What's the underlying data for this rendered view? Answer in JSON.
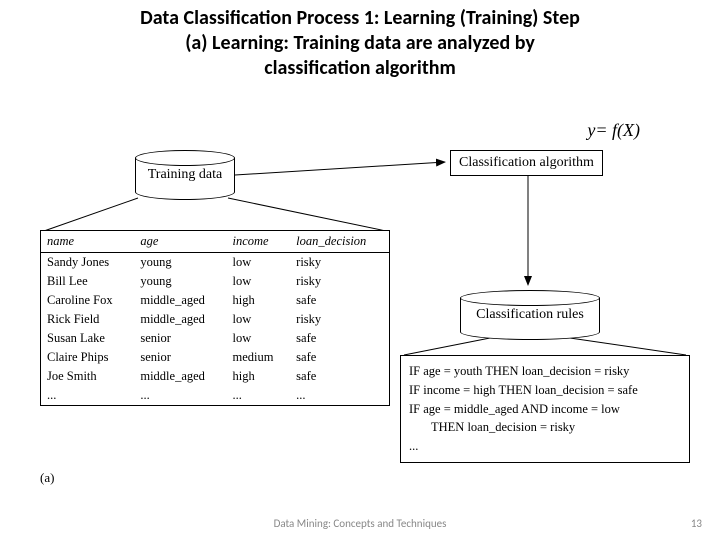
{
  "title": {
    "line1": "Data Classification Process 1: Learning (Training) Step",
    "line2": "(a) Learning: Training data are analyzed by",
    "line3": "classification algorithm"
  },
  "equation": "y= f(X)",
  "labels": {
    "training_data": "Training data",
    "classification_algorithm": "Classification algorithm",
    "classification_rules": "Classification rules",
    "sub": "(a)"
  },
  "table": {
    "headers": [
      "name",
      "age",
      "income",
      "loan_decision"
    ],
    "rows": [
      [
        "Sandy Jones",
        "young",
        "low",
        "risky"
      ],
      [
        "Bill Lee",
        "young",
        "low",
        "risky"
      ],
      [
        "Caroline Fox",
        "middle_aged",
        "high",
        "safe"
      ],
      [
        "Rick Field",
        "middle_aged",
        "low",
        "risky"
      ],
      [
        "Susan Lake",
        "senior",
        "low",
        "safe"
      ],
      [
        "Claire Phips",
        "senior",
        "medium",
        "safe"
      ],
      [
        "Joe Smith",
        "middle_aged",
        "high",
        "safe"
      ],
      [
        "...",
        "...",
        "...",
        "..."
      ]
    ]
  },
  "rules": {
    "r1": "IF age = youth THEN loan_decision = risky",
    "r2": "IF income = high THEN loan_decision = safe",
    "r3a": "IF age = middle_aged AND income = low",
    "r3b": "THEN loan_decision = risky",
    "more": "..."
  },
  "footer": "Data Mining: Concepts and Techniques",
  "page": "13"
}
